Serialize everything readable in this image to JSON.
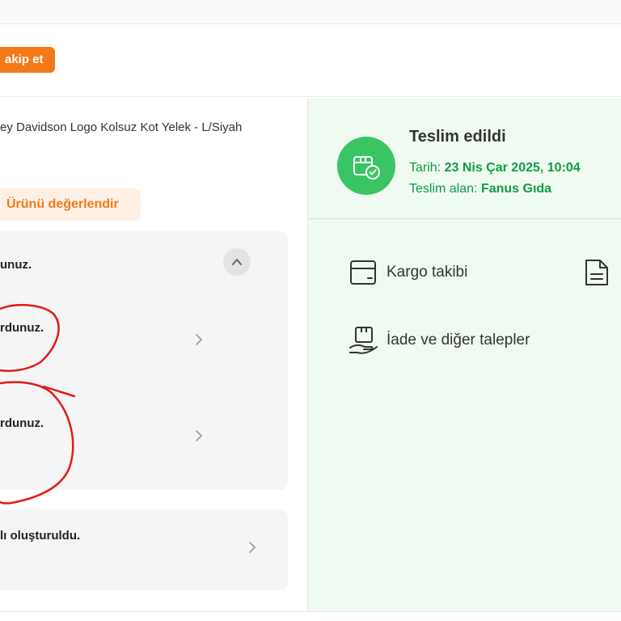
{
  "header": {
    "follow_label": "akip et"
  },
  "product": {
    "name": "ey Davidson Logo Kolsuz Kot Yelek - L/Siyah",
    "review_label": "Ürünü değerlendir"
  },
  "history": {
    "rows": [
      {
        "text": "unuz."
      },
      {
        "text": "rdunuz."
      },
      {
        "text": "rdunuz."
      }
    ],
    "bottom_row": {
      "text": "lı oluşturuldu."
    }
  },
  "delivery": {
    "title": "Teslim edildi",
    "date_label": "Tarih:",
    "date_value": "23 Nis Çar 2025, 10:04",
    "receiver_label": "Teslim alan:",
    "receiver_value": "Fanus Gıda"
  },
  "actions": {
    "cargo": "Kargo takibi",
    "returns": "İade ve diğer talepler"
  },
  "colors": {
    "accent": "#f27a1a",
    "success": "#3bc464",
    "success_text": "#0f9b44",
    "annotation": "#e01b1b"
  }
}
